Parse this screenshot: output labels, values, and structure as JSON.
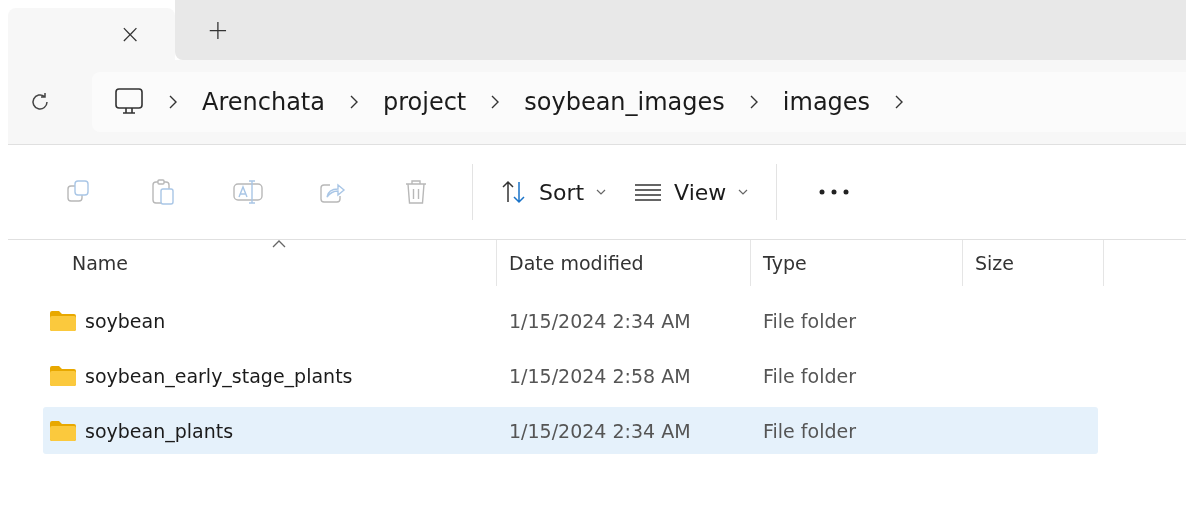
{
  "tab_strip": {
    "close": "×",
    "new_tab": "+"
  },
  "breadcrumb": [
    "Arenchata",
    "project",
    "soybean_images",
    "images"
  ],
  "toolbar": {
    "actions": [
      {
        "kind": "copy",
        "disabled": true
      },
      {
        "kind": "paste",
        "disabled": true
      },
      {
        "kind": "rename",
        "disabled": true
      },
      {
        "kind": "share",
        "disabled": true
      },
      {
        "kind": "delete",
        "disabled": true
      }
    ],
    "sort": "Sort",
    "view": "View"
  },
  "table": {
    "columns": [
      "Name",
      "Date modified",
      "Type",
      "Size"
    ],
    "rows": [
      {
        "name": "soybean",
        "date": "1/15/2024 2:34 AM",
        "type": "File folder",
        "selected": false
      },
      {
        "name": "soybean_early_stage_plants",
        "date": "1/15/2024 2:58 AM",
        "type": "File folder",
        "selected": false
      },
      {
        "name": "soybean_plants",
        "date": "1/15/2024 2:34 AM",
        "type": "File folder",
        "selected": true
      }
    ]
  }
}
